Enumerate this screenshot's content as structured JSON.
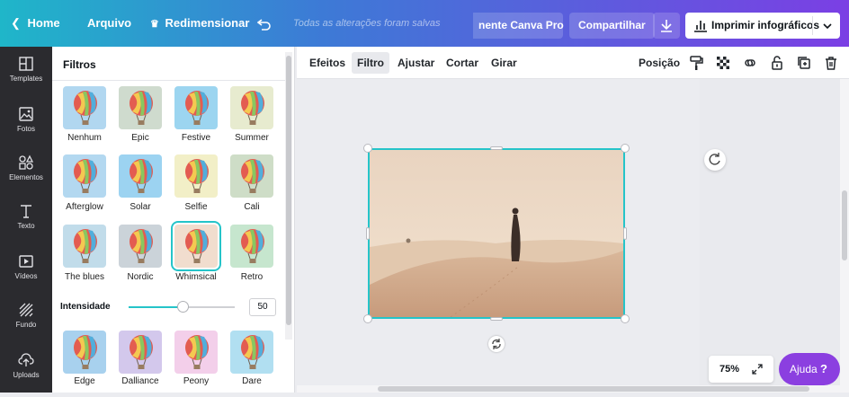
{
  "topbar": {
    "home": "Home",
    "arquivo": "Arquivo",
    "redimensionar": "Redimensionar",
    "status": "Todas as alterações foram salvas",
    "canva_pro": "nente Canva Pro",
    "share": "Compartilhar",
    "print": "Imprimir infográficos"
  },
  "rail": {
    "items": [
      {
        "label": "Templates",
        "icon": "templates-icon"
      },
      {
        "label": "Fotos",
        "icon": "photos-icon"
      },
      {
        "label": "Elementos",
        "icon": "elements-icon"
      },
      {
        "label": "Texto",
        "icon": "text-icon"
      },
      {
        "label": "Vídeos",
        "icon": "video-icon"
      },
      {
        "label": "Fundo",
        "icon": "background-icon"
      },
      {
        "label": "Uploads",
        "icon": "upload-icon"
      }
    ]
  },
  "panel": {
    "title": "Filtros",
    "filters": [
      {
        "name": "Nenhum",
        "sky": "#a7d2ee"
      },
      {
        "name": "Epic",
        "sky": "#c9d6c8"
      },
      {
        "name": "Festive",
        "sky": "#8fd0ee"
      },
      {
        "name": "Summer",
        "sky": "#e4e9c9"
      },
      {
        "name": "Afterglow",
        "sky": "#a9d3ee"
      },
      {
        "name": "Solar",
        "sky": "#8fcdef"
      },
      {
        "name": "Selfie",
        "sky": "#f1edc0"
      },
      {
        "name": "Cali",
        "sky": "#c8d9c0"
      },
      {
        "name": "The blues",
        "sky": "#b9d8e8"
      },
      {
        "name": "Nordic",
        "sky": "#c4cdd4"
      },
      {
        "name": "Whimsical",
        "sky": "#f0d9c8"
      },
      {
        "name": "Retro",
        "sky": "#bfe3c8"
      },
      {
        "name": "Edge",
        "sky": "#9ccbec"
      },
      {
        "name": "Dalliance",
        "sky": "#cdc1ea"
      },
      {
        "name": "Peony",
        "sky": "#f2c9e8"
      },
      {
        "name": "Dare",
        "sky": "#a7dbf0"
      }
    ],
    "selected_filter": "Whimsical",
    "intensity_label": "Intensidade",
    "intensity_value": "50"
  },
  "toolbar": {
    "efeitos": "Efeitos",
    "filtro": "Filtro",
    "ajustar": "Ajustar",
    "cortar": "Cortar",
    "girar": "Girar",
    "posicao": "Posição"
  },
  "canvas": {
    "zoom": "75%",
    "help": "Ajuda",
    "help_mark": "?"
  }
}
